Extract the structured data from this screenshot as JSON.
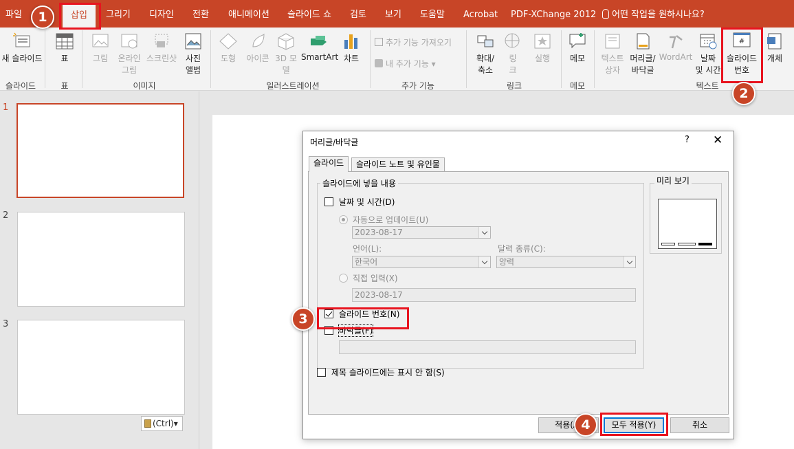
{
  "menubar": {
    "tabs": [
      "파일",
      "삽입",
      "그리기",
      "디자인",
      "전환",
      "애니메이션",
      "슬라이드 쇼",
      "검토",
      "보기",
      "도움말",
      "Acrobat",
      "PDF-XChange 2012"
    ],
    "active_tab": "삽입",
    "tell_me": "어떤 작업을 원하시나요?"
  },
  "ribbon": {
    "new_slide": "새 슬라이드",
    "table": "표",
    "picture": "그림",
    "online_picture_1": "온라인",
    "online_picture_2": "그림",
    "screenshot": "스크린샷",
    "album_1": "사진",
    "album_2": "앨범",
    "shapes": "도형",
    "icons": "아이콘",
    "model_1": "3D 모",
    "model_2": "델",
    "smartart": "SmartArt",
    "chart": "차트",
    "get_addins": "추가 기능 가져오기",
    "my_addins": "내 추가 기능",
    "zoom_1": "확대/",
    "zoom_2": "축소",
    "link_1": "링",
    "link_2": "크",
    "action": "실행",
    "comment": "메모",
    "textbox_1": "텍스트",
    "textbox_2": "상자",
    "header_footer_1": "머리글/",
    "header_footer_2": "바닥글",
    "wordart": "WordArt",
    "datetime_1": "날짜",
    "datetime_2": "및 시간",
    "slide_number_1": "슬라이드",
    "slide_number_2": "번호",
    "object": "개체",
    "groups": {
      "slides": "슬라이드",
      "tables": "표",
      "images": "이미지",
      "illustrations": "일러스트레이션",
      "addins": "추가 기능",
      "links": "링크",
      "comments": "메모",
      "text": "텍스트"
    }
  },
  "thumbnails": {
    "numbers": [
      "1",
      "2",
      "3"
    ],
    "paste_options": "(Ctrl)"
  },
  "dialog": {
    "title": "머리글/바닥글",
    "help": "?",
    "close": "✕",
    "tabs": [
      "슬라이드",
      "슬라이드 노트 및 유인물"
    ],
    "group_label": "슬라이드에 넣을 내용",
    "date_time_label": "날짜 및 시간(D)",
    "date_time_checked": false,
    "auto_update_label": "자동으로 업데이트(U)",
    "auto_date_value": "2023-08-17",
    "language_label": "언어(L):",
    "language_value": "한국어",
    "calendar_label": "달력 종류(C):",
    "calendar_value": "양력",
    "fixed_label": "직접 입력(X)",
    "fixed_value": "2023-08-17",
    "slide_number_label": "슬라이드 번호(N)",
    "slide_number_checked": true,
    "footer_label": "바닥글(F)",
    "footer_checked": false,
    "footer_value": "",
    "dont_show_title_label": "제목 슬라이드에는 표시 안 함(S)",
    "dont_show_title_checked": false,
    "preview_label": "미리 보기",
    "buttons": {
      "apply": "적용(A)",
      "apply_all": "모두 적용(Y)",
      "cancel": "취소"
    }
  },
  "callouts": [
    "1",
    "2",
    "3",
    "4"
  ],
  "colors": {
    "accent": "#c84527",
    "highlight": "#e8141f",
    "focus": "#0078d7"
  }
}
